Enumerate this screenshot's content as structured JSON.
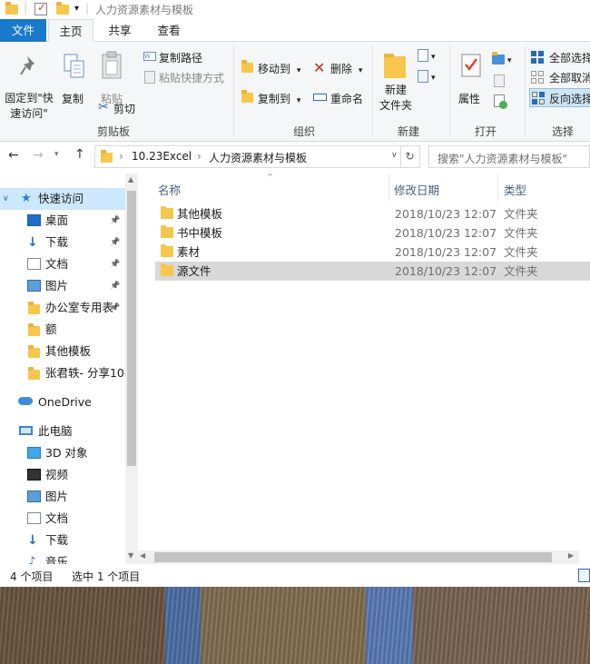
{
  "window": {
    "title": "人力资源素材与模板"
  },
  "tabs": {
    "file": "文件",
    "home": "主页",
    "share": "共享",
    "view": "查看"
  },
  "ribbon": {
    "clipboard": {
      "pin_label_1": "固定到\"快",
      "pin_label_2": "速访问\"",
      "copy": "复制",
      "paste": "粘贴",
      "copy_path": "复制路径",
      "paste_shortcut": "粘贴快捷方式",
      "cut": "剪切",
      "group": "剪贴板"
    },
    "organize": {
      "move_to": "移动到",
      "copy_to": "复制到",
      "delete": "删除",
      "rename": "重命名",
      "group": "组织"
    },
    "new": {
      "new_folder_1": "新建",
      "new_folder_2": "文件夹",
      "group": "新建"
    },
    "open": {
      "properties": "属性",
      "group": "打开"
    },
    "select": {
      "select_all": "全部选择",
      "select_none": "全部取消",
      "invert": "反向选择",
      "group": "选择"
    }
  },
  "address": {
    "path": "10.23Excel",
    "sep": "›",
    "current": "人力资源素材与模板",
    "search_placeholder": "搜索\"人力资源素材与模板\""
  },
  "nav": {
    "quick_access": "快速访问",
    "quick_items": [
      {
        "label": "桌面",
        "pinned": true,
        "icon": "desktop-icon"
      },
      {
        "label": "下载",
        "pinned": true,
        "icon": "download-icon"
      },
      {
        "label": "文档",
        "pinned": true,
        "icon": "document-icon"
      },
      {
        "label": "图片",
        "pinned": true,
        "icon": "picture-icon"
      },
      {
        "label": "办公室专用表",
        "pinned": true,
        "icon": "folder-icon"
      },
      {
        "label": "额",
        "pinned": false,
        "icon": "folder-icon"
      },
      {
        "label": "其他模板",
        "pinned": false,
        "icon": "folder-icon"
      },
      {
        "label": "张君轶- 分享10-",
        "pinned": false,
        "icon": "folder-icon"
      }
    ],
    "onedrive": "OneDrive",
    "this_pc": "此电脑",
    "pc_items": [
      {
        "label": "3D 对象",
        "icon": "3d-objects-icon"
      },
      {
        "label": "视频",
        "icon": "video-icon"
      },
      {
        "label": "图片",
        "icon": "picture-icon"
      },
      {
        "label": "文档",
        "icon": "document-icon"
      },
      {
        "label": "下载",
        "icon": "download-icon"
      },
      {
        "label": "音乐",
        "icon": "music-icon"
      }
    ]
  },
  "columns": {
    "name": "名称",
    "modified": "修改日期",
    "type": "类型"
  },
  "files": [
    {
      "name": "其他模板",
      "date": "2018/10/23 12:07",
      "type": "文件夹",
      "selected": false
    },
    {
      "name": "书中模板",
      "date": "2018/10/23 12:07",
      "type": "文件夹",
      "selected": false
    },
    {
      "name": "素材",
      "date": "2018/10/23 12:07",
      "type": "文件夹",
      "selected": false
    },
    {
      "name": "源文件",
      "date": "2018/10/23 12:07",
      "type": "文件夹",
      "selected": true
    }
  ],
  "status": {
    "count": "4 个项目",
    "selected": "选中 1 个项目"
  },
  "colors": {
    "accent": "#1979ca",
    "selection": "#cce8ff",
    "folder": "#f6c74b"
  }
}
